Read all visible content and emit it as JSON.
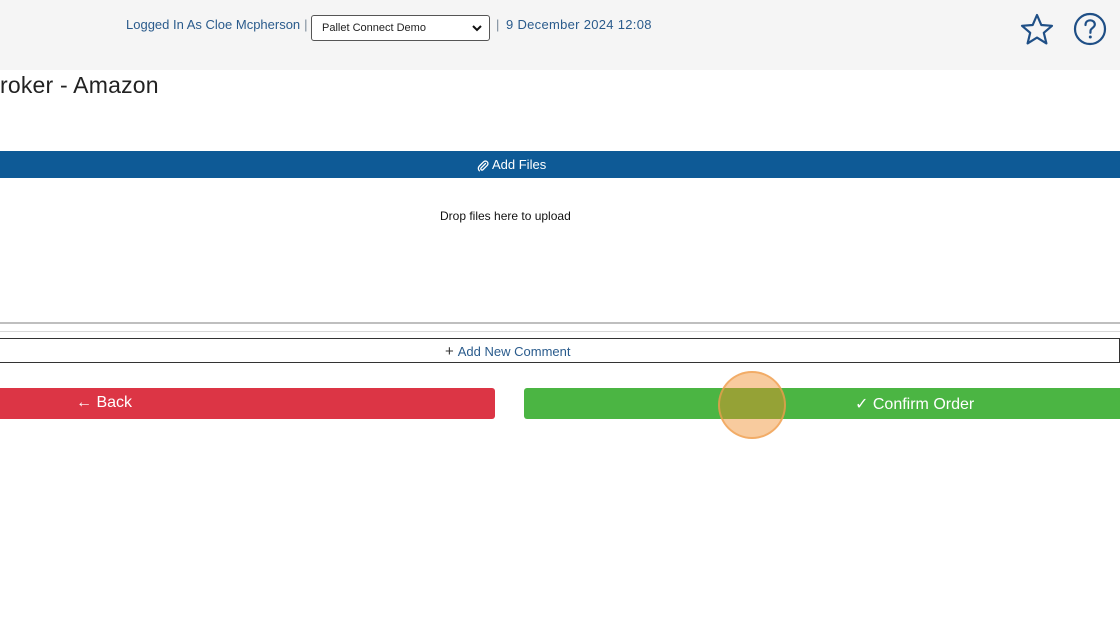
{
  "header": {
    "logged_in_label": "Logged In As Cloe Mcpherson",
    "separator": "|",
    "company_select": {
      "value": "Pallet Connect Demo"
    },
    "datetime": "9 December 2024 12:08",
    "favorite_icon": "star-outline-icon",
    "help_icon": "question-circle-icon"
  },
  "page": {
    "title": "roker - Amazon"
  },
  "files": {
    "add_files_label": "Add Files",
    "add_files_icon": "paperclip-icon",
    "dropzone_text": "Drop files here to upload"
  },
  "comments": {
    "add_comment_label": "Add New Comment",
    "add_comment_icon": "plus-icon"
  },
  "actions": {
    "back_label": "Back",
    "back_icon": "arrow-left-icon",
    "confirm_label": "Confirm Order",
    "confirm_icon": "check-icon"
  },
  "colors": {
    "brand_blue": "#0e5a96",
    "link_blue": "#2a5b8c",
    "back_red": "#dc3545",
    "confirm_green": "#4bb543",
    "click_marker": "#f08c28"
  }
}
